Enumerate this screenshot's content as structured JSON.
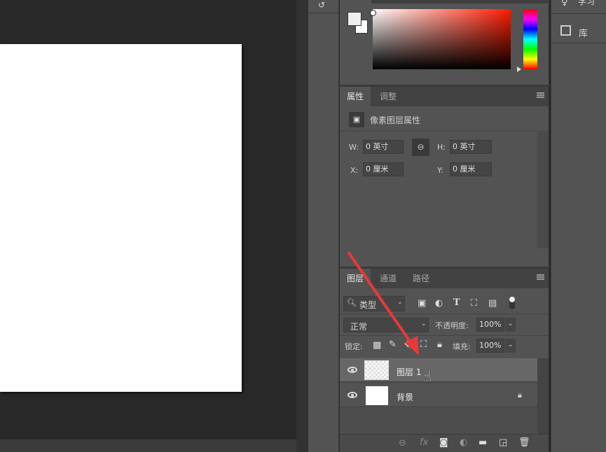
{
  "right_panel": {
    "learn_label": "学习",
    "library_label": "库"
  },
  "properties": {
    "tabs": [
      {
        "label": "属性"
      },
      {
        "label": "调整"
      }
    ],
    "title": "像素图层属性",
    "w_label": "W:",
    "w_value": "0 英寸",
    "h_label": "H:",
    "h_value": "0 英寸",
    "x_label": "X:",
    "x_value": "0 厘米",
    "y_label": "Y:",
    "y_value": "0 厘米"
  },
  "layers": {
    "tabs": [
      {
        "label": "图层"
      },
      {
        "label": "通道"
      },
      {
        "label": "路径"
      }
    ],
    "filter_label": "类型",
    "blend_mode": "正常",
    "opacity_label": "不透明度:",
    "opacity_value": "100%",
    "lock_label": "锁定:",
    "fill_label": "填充:",
    "fill_value": "100%",
    "items": [
      {
        "name": "图层 1",
        "selected": true,
        "locked": false
      },
      {
        "name": "背景",
        "selected": false,
        "locked": true
      }
    ]
  },
  "colors": {
    "accent_arrow": "#e8393a",
    "panel_bg": "#535353"
  }
}
